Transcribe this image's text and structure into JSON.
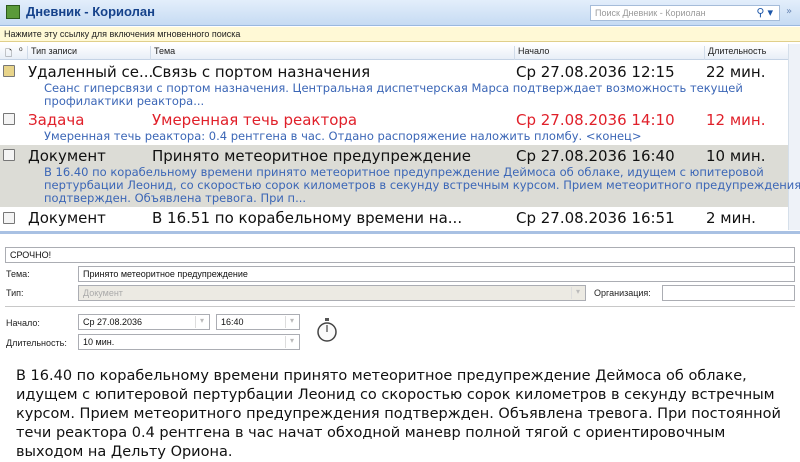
{
  "window": {
    "title": "Дневник - Кориолан",
    "search_placeholder": "Поиск Дневник - Кориолан"
  },
  "infobar": "Нажмите эту ссылку для включения мгновенного поиска",
  "columns": {
    "type": "Тип записи",
    "subject": "Тема",
    "start": "Начало",
    "duration": "Длительность"
  },
  "entries": [
    {
      "type": "Удаленный се...",
      "subject": "Связь с портом назначения",
      "start": "Ср 27.08.2036 12:15",
      "duration": "22 мин.",
      "preview": [
        "Сеанс гиперсвязи с портом назначения. Центральная диспетчерская Марса подтверждает возможность текущей",
        "профилактики реактора..."
      ]
    },
    {
      "type": "Задача",
      "subject": "Умеренная течь реактора",
      "start": "Ср 27.08.2036 14:10",
      "duration": "12 мин.",
      "preview": [
        "Умеренная течь реактора: 0.4 рентгена в час. Отдано распоряжение наложить пломбу. <конец>"
      ]
    },
    {
      "type": "Документ",
      "subject": "Принято метеоритное предупреждение",
      "start": "Ср 27.08.2036 16:40",
      "duration": "10 мин.",
      "preview": [
        "В 16.40 по корабельному времени принято метеоритное предупреждение Деймоса об облаке, идущем с юпитеровой",
        "пертурбации Леонид, со скоростью сорок километров в секунду встречным курсом. Прием метеоритного предупреждения",
        "подтвержден. Объявлена тревога. При п..."
      ]
    },
    {
      "type": "Документ",
      "subject": "В 16.51 по корабельному времени на...",
      "start": "Ср 27.08.2036 16:51",
      "duration": "2 мин."
    }
  ],
  "form": {
    "urgent": "СРОЧНО!",
    "subject_label": "Тема:",
    "subject": "Принято метеоритное предупреждение",
    "type_label": "Тип:",
    "type": "Документ",
    "org_label": "Организация:",
    "org": "",
    "start_label": "Начало:",
    "start_date": "Ср 27.08.2036",
    "start_time": "16:40",
    "duration_label": "Длительность:",
    "duration": "10 мин.",
    "body": "В 16.40 по корабельному времени принято метеоритное предупреждение Деймоса об облаке, идущем с юпитеровой пертурбации Леонид  со  скоростью сорок километров в секунду встречным курсом. Прием метеоритного предупреждения подтвержден. Объявлена тревога. При постоянной течи реактора 0.4 рентгена в час начат обходной маневр полной тягой с ориентировочным выходом на Дельту Ориона."
  }
}
